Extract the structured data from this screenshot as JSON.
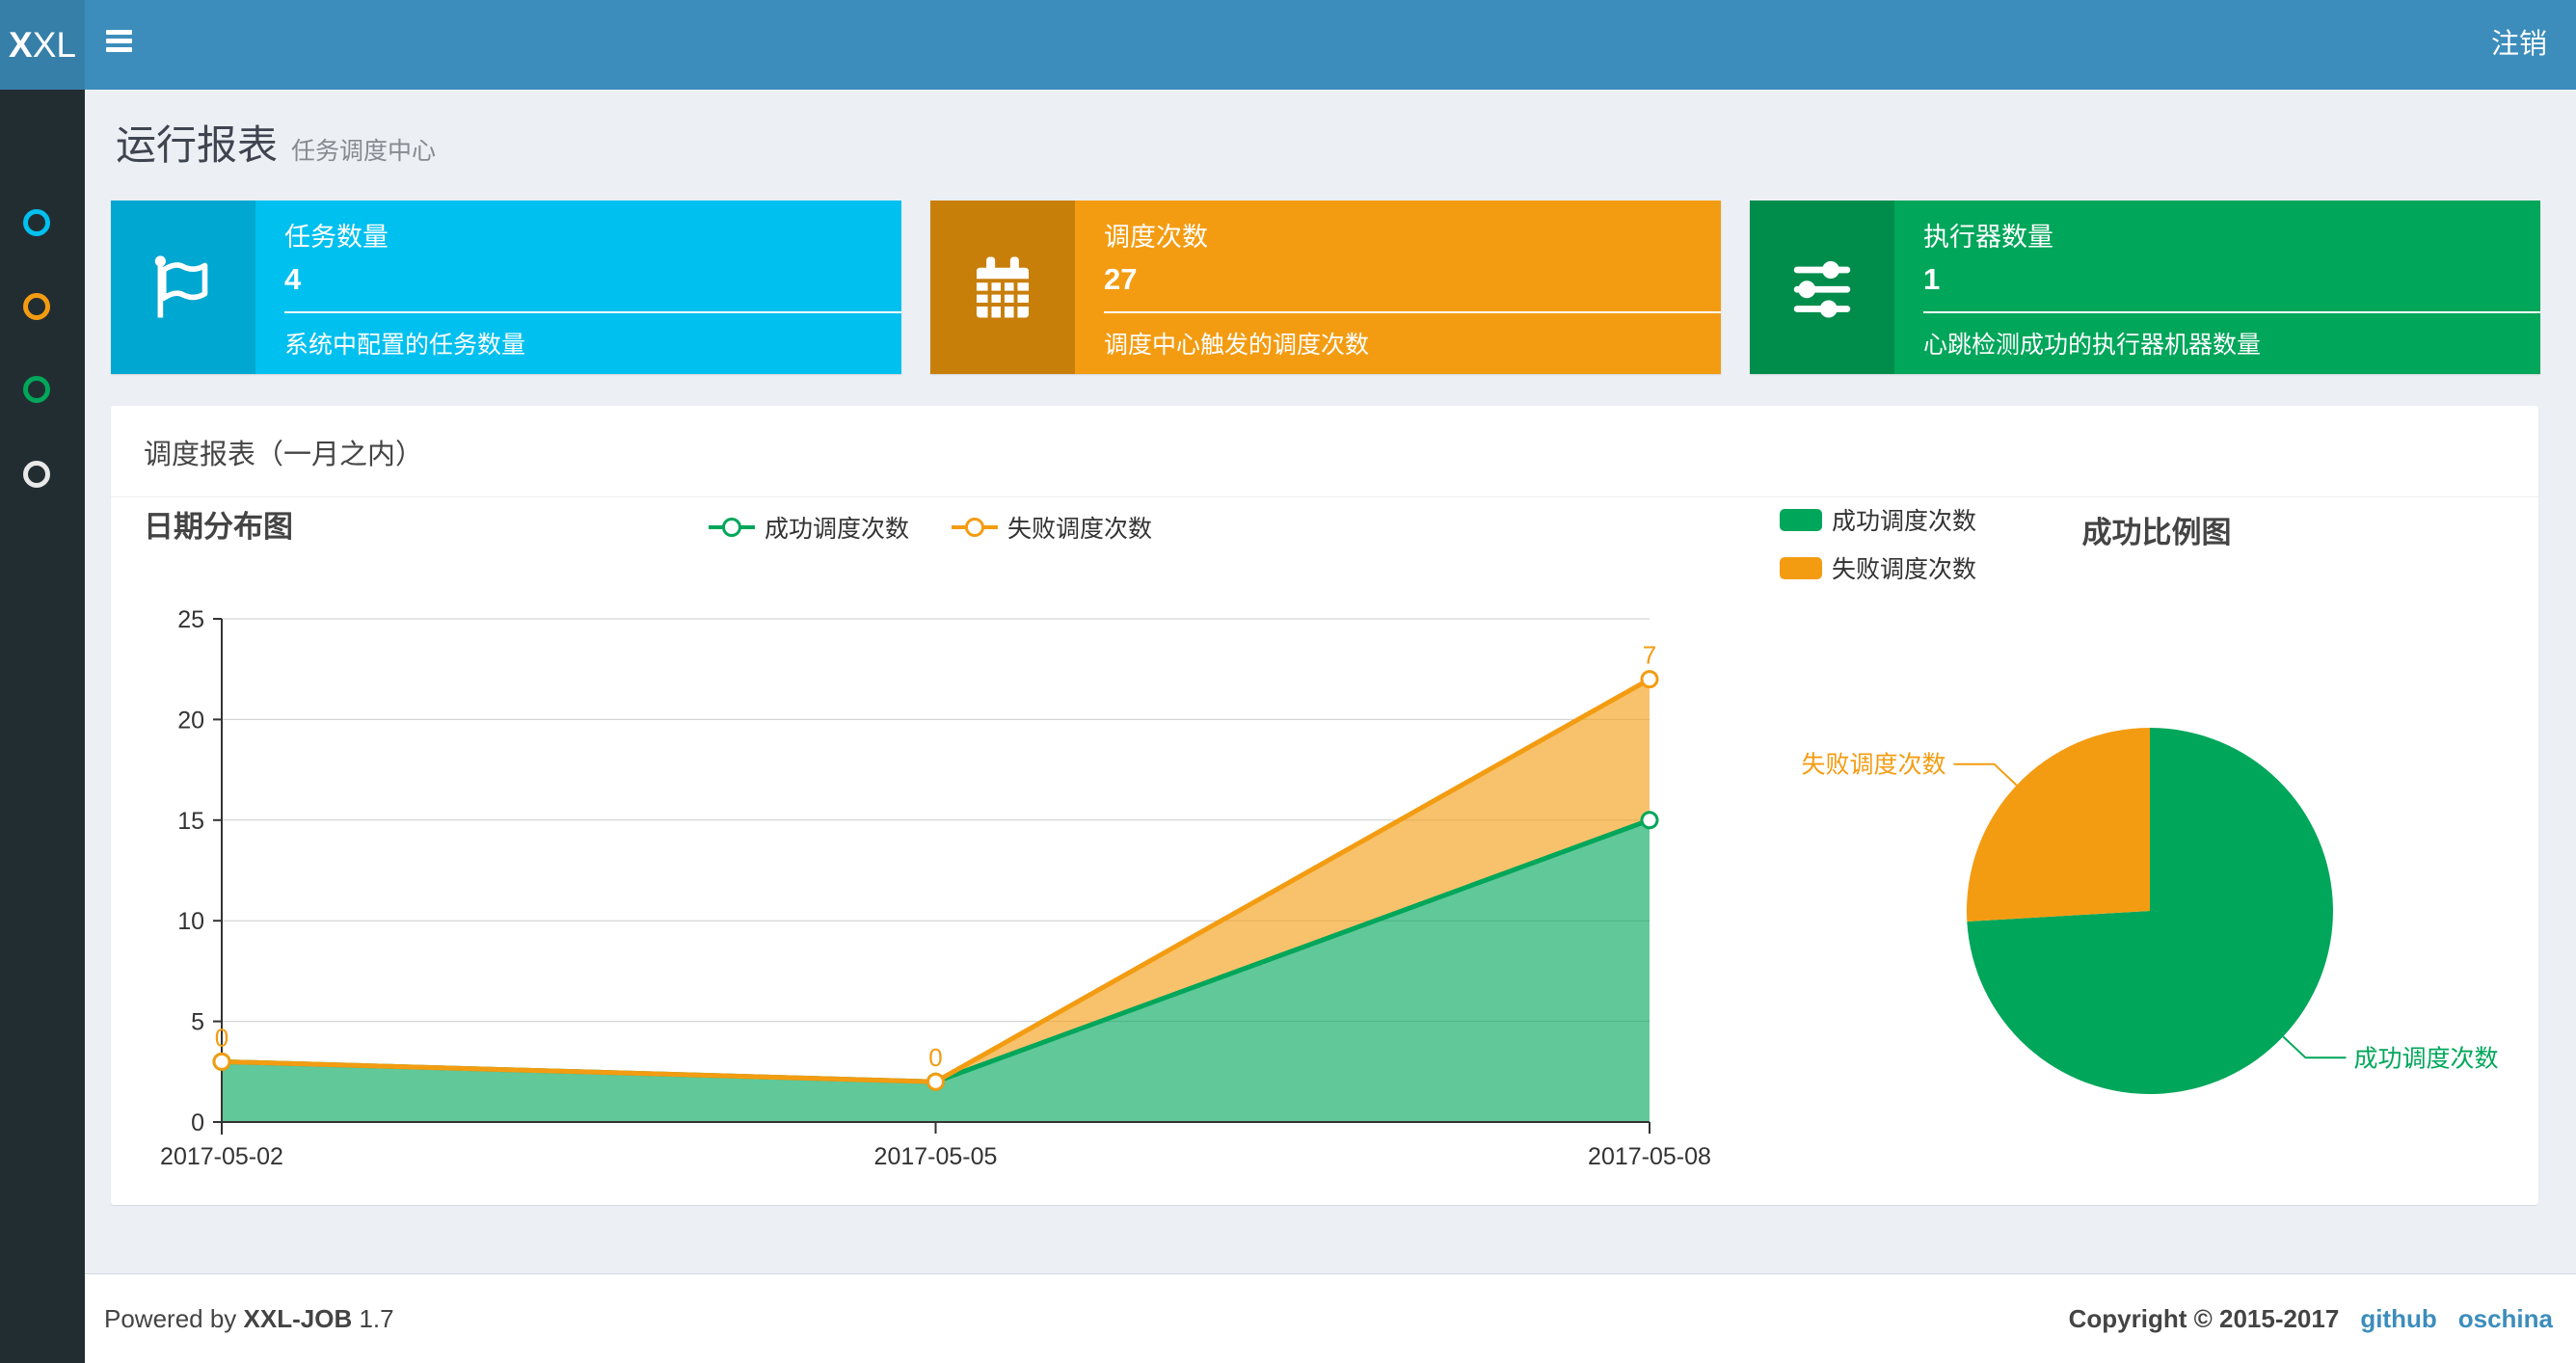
{
  "navbar": {
    "logo_bold": "X",
    "logo_rest": "XL",
    "logout": "注销"
  },
  "sidebar": {
    "items": [
      {
        "icon": "circle-icon",
        "color": "#00c0ef"
      },
      {
        "icon": "circle-icon",
        "color": "#f39c12"
      },
      {
        "icon": "circle-icon",
        "color": "#00a65a"
      },
      {
        "icon": "circle-icon",
        "color": "#e8e8e8"
      }
    ]
  },
  "header": {
    "title": "运行报表",
    "subtitle": "任务调度中心"
  },
  "stat_cards": [
    {
      "icon": "flag-icon",
      "title": "任务数量",
      "value": "4",
      "desc": "系统中配置的任务数量",
      "color": "#00c0ef",
      "icon_bg": "#00a7d0"
    },
    {
      "icon": "calendar-icon",
      "title": "调度次数",
      "value": "27",
      "desc": "调度中心触发的调度次数",
      "color": "#f39c12",
      "icon_bg": "#c87f0a"
    },
    {
      "icon": "sliders-icon",
      "title": "执行器数量",
      "value": "1",
      "desc": "心跳检测成功的执行器机器数量",
      "color": "#00a65a",
      "icon_bg": "#008d4c"
    }
  ],
  "panel": {
    "title": "调度报表（一月之内）"
  },
  "chart_data": [
    {
      "type": "area",
      "title": "日期分布图",
      "categories": [
        "2017-05-02",
        "2017-05-05",
        "2017-05-08"
      ],
      "series": [
        {
          "name": "成功调度次数",
          "values": [
            3,
            2,
            15
          ],
          "color": "#00a65a"
        },
        {
          "name": "失败调度次数",
          "values": [
            0,
            0,
            7
          ],
          "color": "#f39c12"
        }
      ],
      "stacked": true,
      "point_labels_series": "失败调度次数",
      "point_labels": [
        0,
        0,
        7
      ],
      "ylim": [
        0,
        25
      ],
      "yticks": [
        0,
        5,
        10,
        15,
        20,
        25
      ],
      "grid": true,
      "legend_position": "top-center"
    },
    {
      "type": "pie",
      "title": "成功比例图",
      "slices": [
        {
          "label": "成功调度次数",
          "value": 20,
          "color": "#00a65a"
        },
        {
          "label": "失败调度次数",
          "value": 7,
          "color": "#f39c12"
        }
      ],
      "start_angle": "top",
      "direction": "clockwise",
      "legend_position": "top-left"
    }
  ],
  "footer": {
    "powered_by": "Powered by",
    "product": "XXL-JOB",
    "version": "1.7",
    "copyright": "Copyright © 2015-2017",
    "links": [
      {
        "label": "github",
        "color": "#3c8dbc"
      },
      {
        "label": "oschina",
        "color": "#3c8dbc"
      }
    ]
  }
}
